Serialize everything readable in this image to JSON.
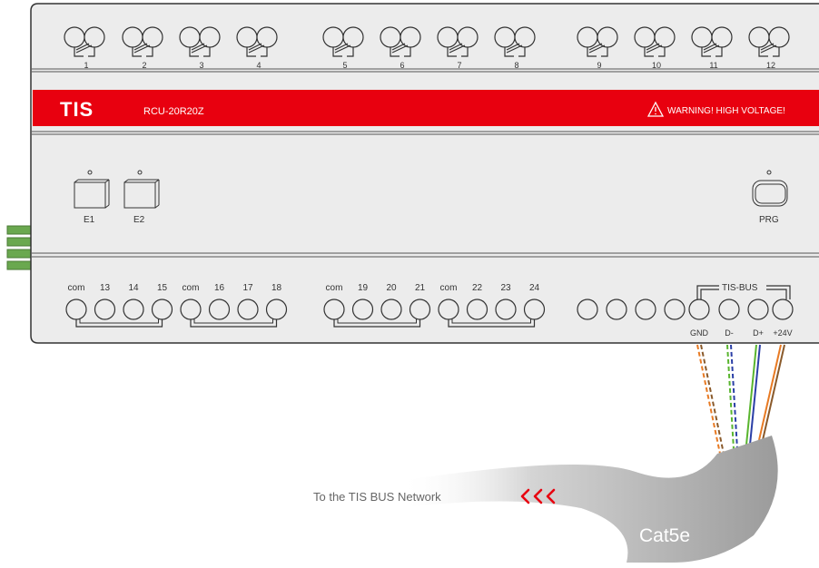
{
  "device": {
    "brand": "TIS",
    "model": "RCU-20R20Z",
    "warning": "WARNING! HIGH VOLTAGE!",
    "relay_numbers": [
      "1",
      "2",
      "3",
      "4",
      "5",
      "6",
      "7",
      "8",
      "9",
      "10",
      "11",
      "12"
    ],
    "buttons": [
      "E1",
      "E2"
    ],
    "prg_label": "PRG",
    "input_labels": [
      "com",
      "13",
      "14",
      "15",
      "com",
      "16",
      "17",
      "18",
      "com",
      "19",
      "20",
      "21",
      "com",
      "22",
      "23",
      "24"
    ],
    "bus_title": "TIS-BUS",
    "bus_labels": [
      "GND",
      "D-",
      "D+",
      "+24V"
    ]
  },
  "cable": {
    "label": "Cat5e",
    "network_text": "To the TIS BUS Network"
  },
  "colors": {
    "banner_red": "#e8000f",
    "housing": "#ececec",
    "outline": "#333333",
    "cable_gray": "#9b9b9b",
    "wire_orange": "#e87a23",
    "wire_green": "#59b52e",
    "wire_blue": "#2b3fa6",
    "wire_brown": "#8a5a2b",
    "arrow_red": "#e8000f"
  },
  "icons": [
    "warning-icon",
    "arrow-left-icon"
  ]
}
